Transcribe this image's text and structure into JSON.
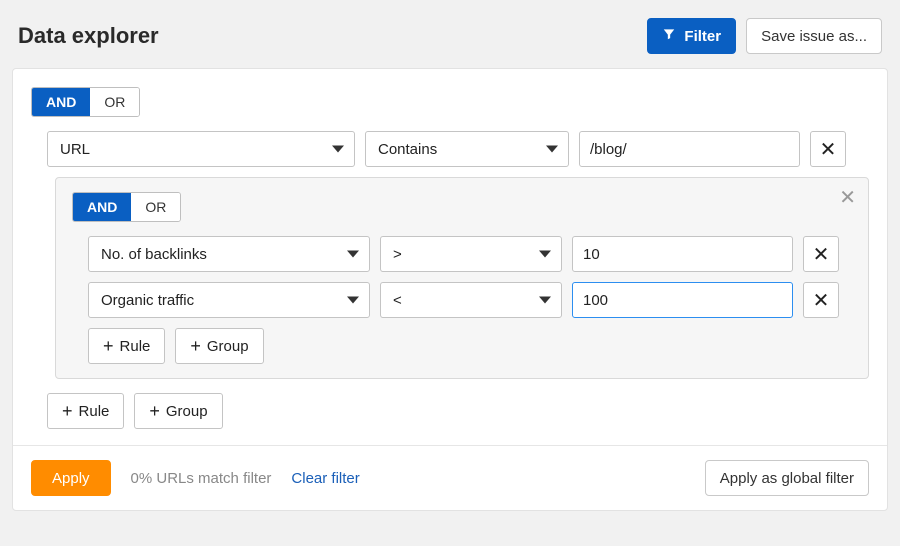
{
  "header": {
    "title": "Data explorer",
    "filter_btn": "Filter",
    "save_btn": "Save issue as..."
  },
  "logic": {
    "and": "AND",
    "or": "OR"
  },
  "root_rule": {
    "field": "URL",
    "operator": "Contains",
    "value": "/blog/"
  },
  "nested_rules": [
    {
      "field": "No. of backlinks",
      "operator": ">",
      "value": "10"
    },
    {
      "field": "Organic traffic",
      "operator": "<",
      "value": "100"
    }
  ],
  "add": {
    "rule": "Rule",
    "group": "Group"
  },
  "footer": {
    "apply": "Apply",
    "match_text": "0% URLs match filter",
    "clear": "Clear filter",
    "apply_global": "Apply as global filter"
  }
}
